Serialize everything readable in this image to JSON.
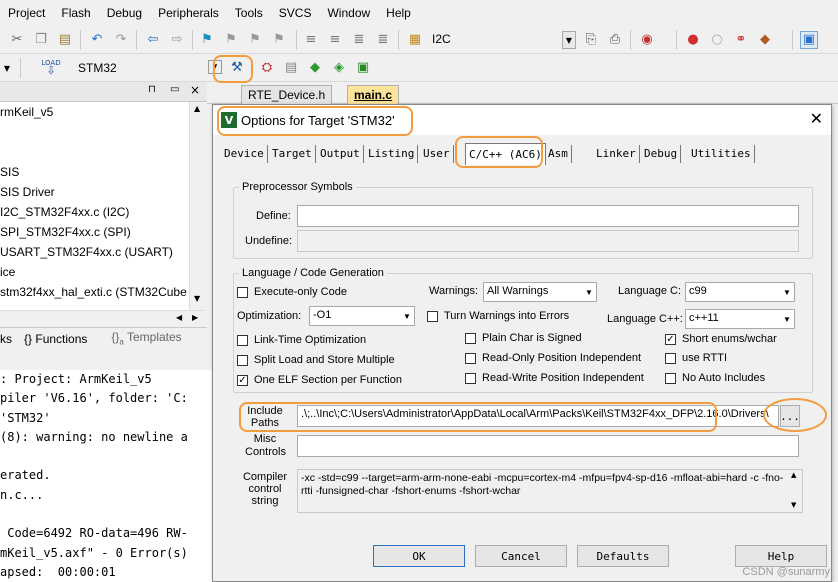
{
  "menubar": {
    "items": [
      "Project",
      "Flash",
      "Debug",
      "Peripherals",
      "Tools",
      "SVCS",
      "Window",
      "Help"
    ]
  },
  "toolbar1": {
    "target_combo": "I2C"
  },
  "toolbar2": {
    "target_name": "STM32",
    "load_label": "LOAD"
  },
  "project": {
    "tree": [
      "rmKeil_v5",
      "SIS",
      "SIS Driver",
      "I2C_STM32F4xx.c (I2C)",
      "SPI_STM32F4xx.c (SPI)",
      "USART_STM32F4xx.c (USART)",
      "ice",
      "stm32f4xx_hal_exti.c (STM32Cube H"
    ],
    "tabs": [
      "ks",
      "Functions",
      "Templates"
    ]
  },
  "build_output": {
    "lines": [
      ": Project: ArmKeil_v5",
      "piler 'V6.16', folder: 'C:",
      "'STM32'",
      "(8): warning: no newline a",
      "",
      "erated.",
      "n.c...",
      "",
      " Code=6492 RO-data=496 RW-",
      "mKeil_v5.axf\" - 0 Error(s)",
      "apsed:  00:00:01"
    ]
  },
  "editor_tabs": [
    "RTE_Device.h",
    "main.c"
  ],
  "dialog": {
    "title": "Options for Target 'STM32'",
    "tabs": [
      "Device",
      "Target",
      "Output",
      "Listing",
      "User",
      "C/C++ (AC6)",
      "Asm",
      "Linker",
      "Debug",
      "Utilities"
    ],
    "preprocessor": {
      "label": "Preprocessor Symbols",
      "define_label": "Define:",
      "define_value": "",
      "undefine_label": "Undefine:",
      "undefine_value": ""
    },
    "language": {
      "label": "Language / Code Generation",
      "execute_only": "Execute-only Code",
      "optimization_label": "Optimization:",
      "optimization_value": "-O1",
      "lto": "Link-Time Optimization",
      "split_load": "Split Load and Store Multiple",
      "one_elf": "One ELF Section per Function",
      "warnings_label": "Warnings:",
      "warnings_value": "All Warnings",
      "turn_warnings": "Turn Warnings into Errors",
      "plain_char": "Plain Char is Signed",
      "ro_pos": "Read-Only Position Independent",
      "rw_pos": "Read-Write Position Independent",
      "lang_c_label": "Language C:",
      "lang_c_value": "c99",
      "lang_cpp_label": "Language C++:",
      "lang_cpp_value": "c++11",
      "short_enums": "Short enums/wchar",
      "use_rtti": "use RTTI",
      "no_auto": "No Auto Includes"
    },
    "include_label": "Include Paths",
    "include_value": ".\\;..\\Inc\\;C:\\Users\\Administrator\\AppData\\Local\\Arm\\Packs\\Keil\\STM32F4xx_DFP\\2.16.0\\Drivers\\",
    "browse_label": "...",
    "misc_label": "Misc Controls",
    "misc_value": "",
    "compiler_label": "Compiler control string",
    "compiler_value": "-xc -std=c99 --target=arm-arm-none-eabi -mcpu=cortex-m4 -mfpu=fpv4-sp-d16 -mfloat-abi=hard -c -fno-rtti -funsigned-char -fshort-enums -fshort-wchar",
    "buttons": {
      "ok": "OK",
      "cancel": "Cancel",
      "defaults": "Defaults",
      "help": "Help"
    }
  },
  "watermark": "CSDN @sunarmy"
}
